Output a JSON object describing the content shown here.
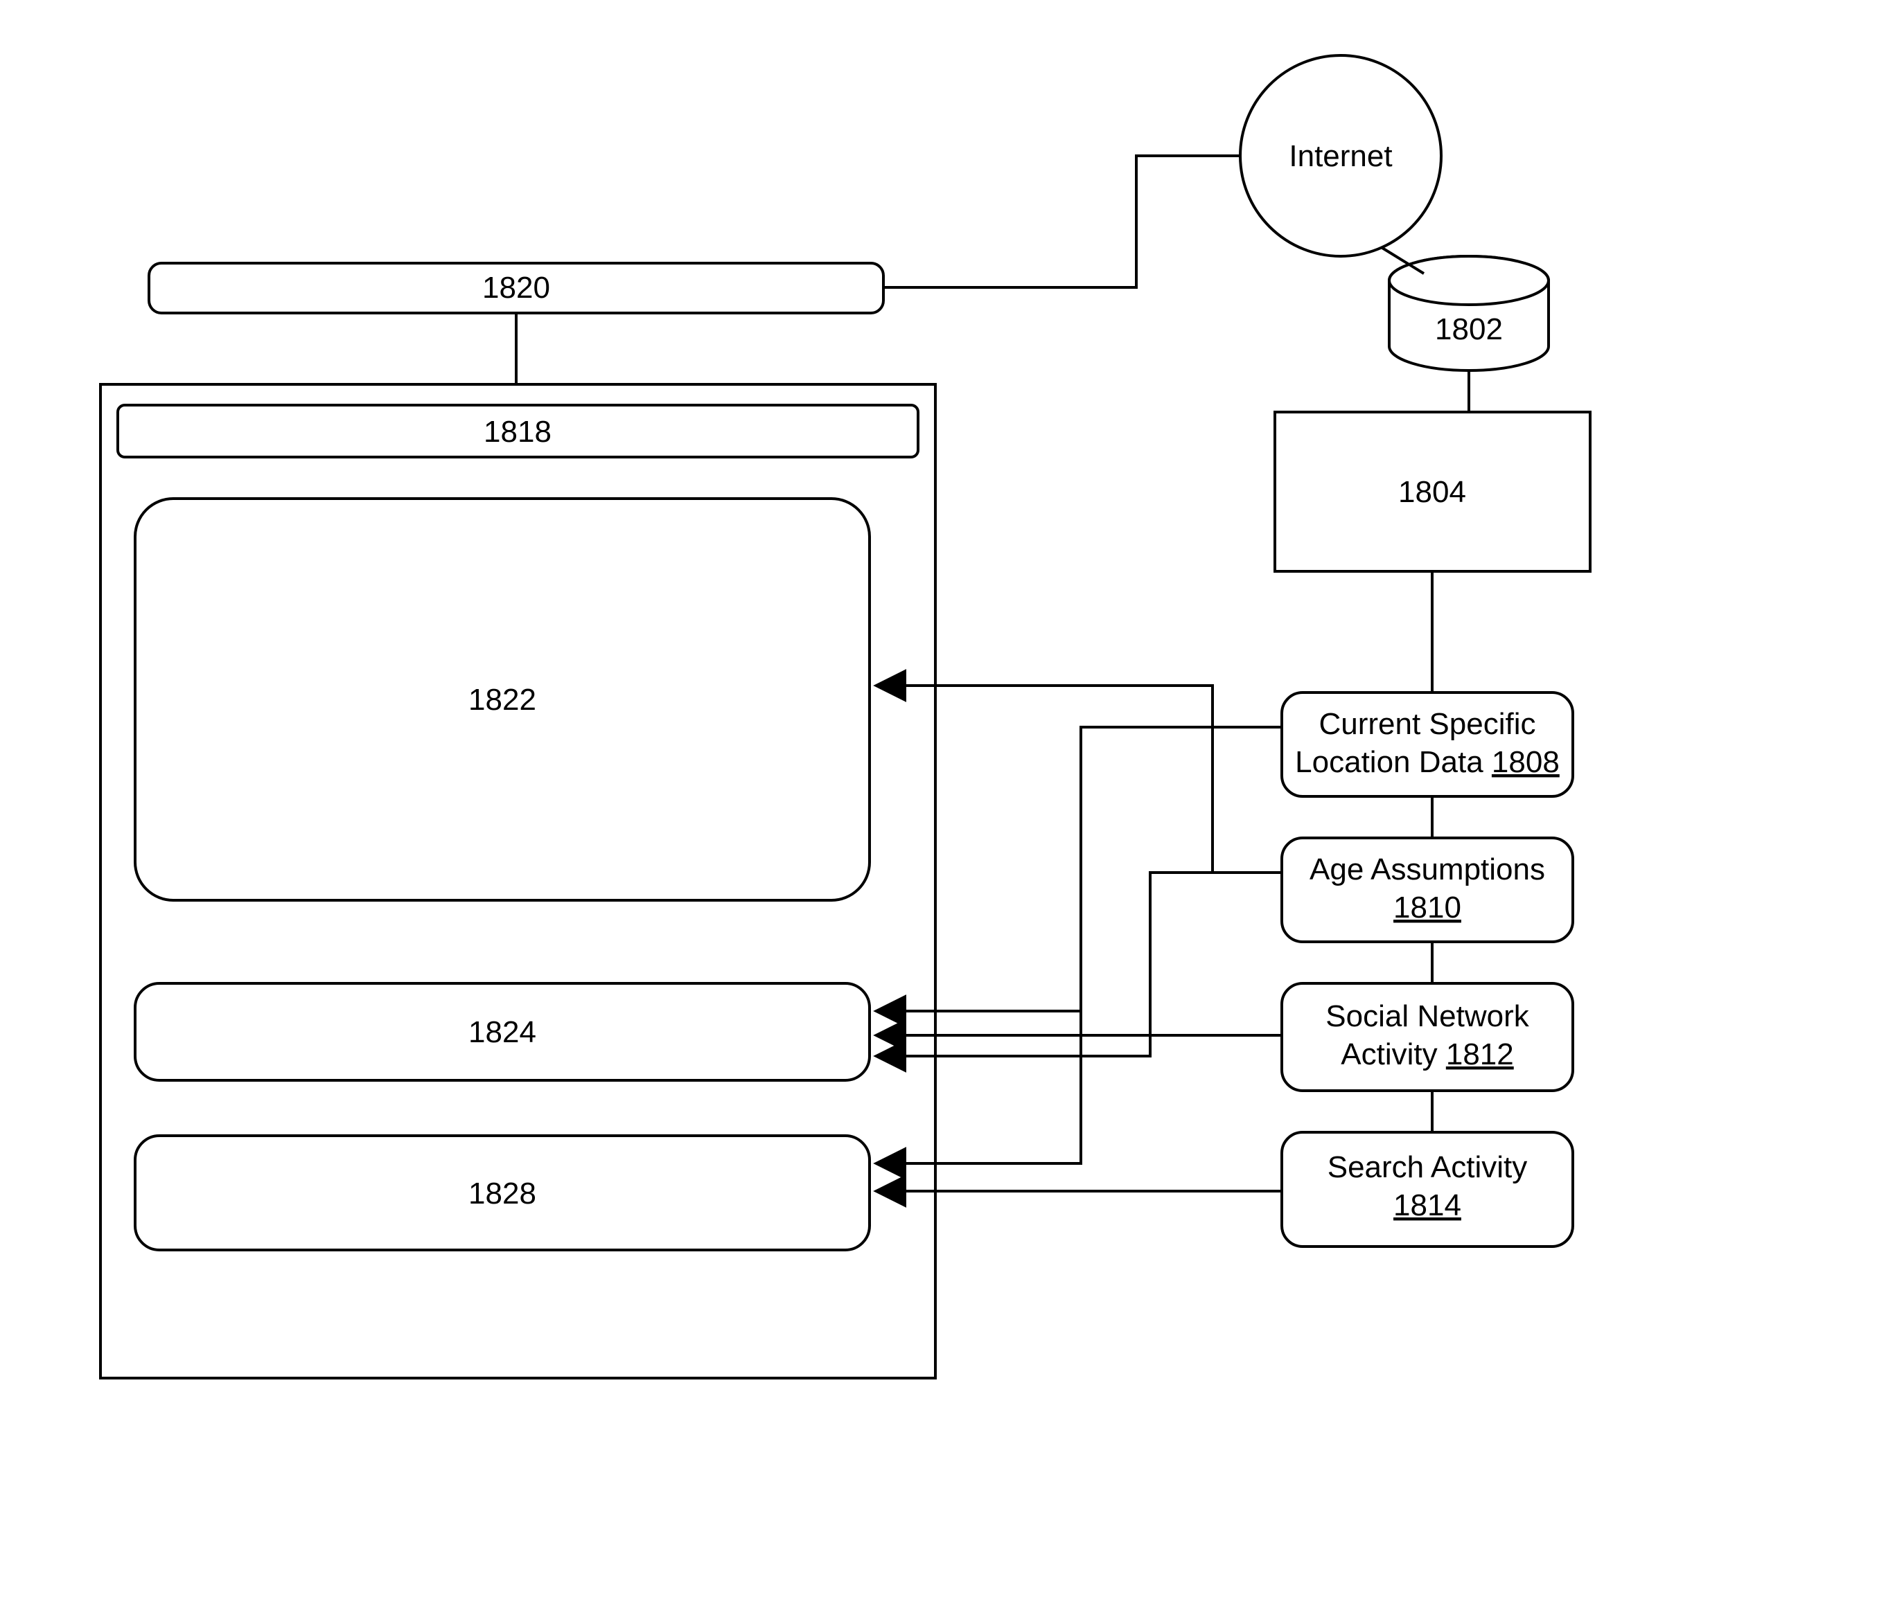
{
  "nodes": {
    "internet": {
      "label": "Internet"
    },
    "db": {
      "ref": "1802"
    },
    "server": {
      "ref": "1804"
    },
    "bar": {
      "ref": "1820"
    },
    "panel_header": {
      "ref": "1818"
    },
    "panel_big": {
      "ref": "1822"
    },
    "panel_mid": {
      "ref": "1824"
    },
    "panel_low": {
      "ref": "1828"
    },
    "loc": {
      "line1": "Current  Specific",
      "line2": "Location Data ",
      "ref": "1808"
    },
    "age": {
      "line1": "Age Assumptions",
      "ref": "1810"
    },
    "soc": {
      "line1": "Social Network",
      "line2": "Activity ",
      "ref": "1812"
    },
    "srch": {
      "line1": "Search Activity",
      "ref": "1814"
    }
  }
}
